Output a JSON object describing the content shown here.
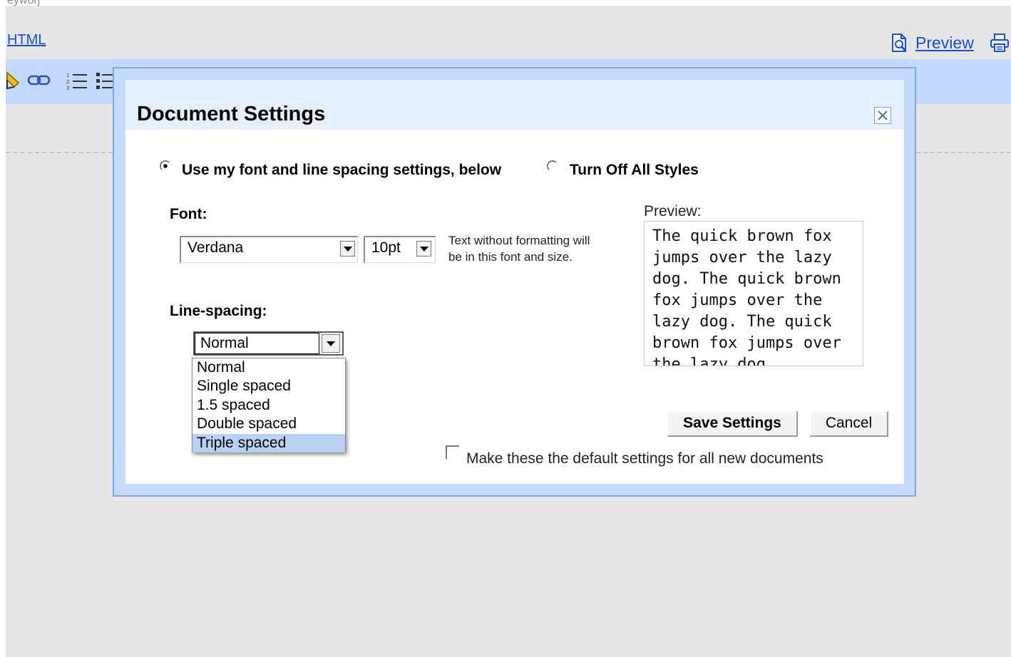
{
  "background": {
    "cut_text": "eyworj",
    "html_link": "HTML",
    "preview_link": "Preview"
  },
  "dialog": {
    "title": "Document Settings",
    "radio_use_settings": "Use my font and line spacing settings, below",
    "radio_turn_off": "Turn Off All Styles",
    "selected_mode": "use_settings",
    "font_label": "Font:",
    "font_value": "Verdana",
    "size_value": "10pt",
    "font_note_line1": "Text without formatting will",
    "font_note_line2": "be in this font and size.",
    "line_spacing_label": "Line-spacing:",
    "line_spacing_value": "Normal",
    "line_spacing_options": [
      "Normal",
      "Single spaced",
      "1.5 spaced",
      "Double spaced",
      "Triple spaced"
    ],
    "highlighted_option": "Triple spaced",
    "preview_label": "Preview:",
    "preview_text": "The quick brown fox jumps over the lazy dog. The quick brown fox jumps over the lazy dog. The quick brown fox jumps over the lazy dog.",
    "save_button": "Save Settings",
    "cancel_button": "Cancel",
    "default_checkbox_label": "Make these the default settings for all new documents",
    "default_checked": false
  },
  "colors": {
    "toolbar": "#c3d9ff",
    "dialog_header": "#e6efff",
    "link": "#1a4ccf",
    "highlight": "#b9d1f5"
  },
  "icons": [
    "highlight-icon",
    "link-icon",
    "numbered-list-icon",
    "bullet-list-icon",
    "preview-icon",
    "print-icon",
    "close-icon"
  ]
}
